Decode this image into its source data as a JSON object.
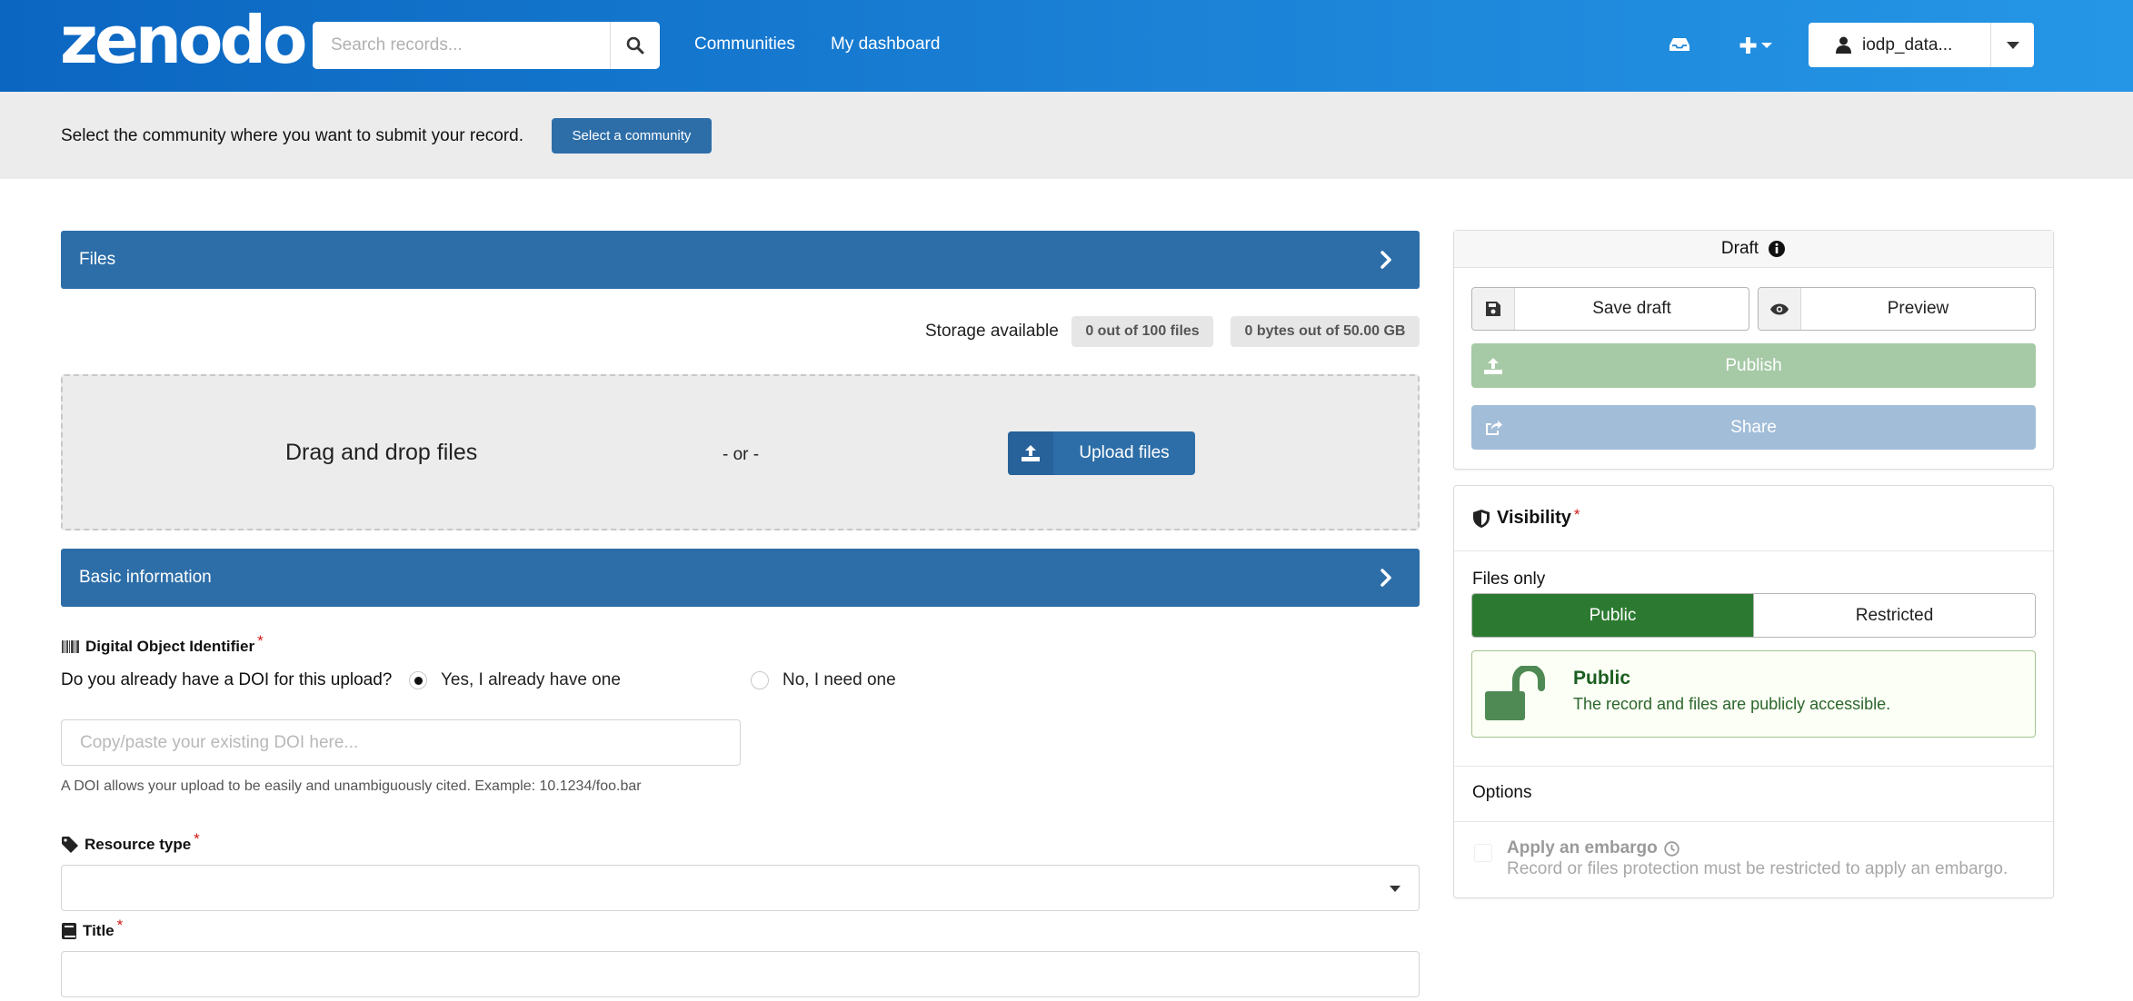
{
  "header": {
    "logo": "zenodo",
    "search_placeholder": "Search records...",
    "nav": [
      "Communities",
      "My dashboard"
    ],
    "user_label": "iodp_data..."
  },
  "community_bar": {
    "text": "Select the community where you want to submit your record.",
    "button": "Select a community"
  },
  "files": {
    "section_title": "Files",
    "storage_label": "Storage available",
    "files_quota": "0 out of 100 files",
    "bytes_quota": "0 bytes out of 50.00 GB",
    "drop_text": "Drag and drop files",
    "or_text": "- or -",
    "upload_button": "Upload files"
  },
  "basic_info": {
    "section_title": "Basic information",
    "doi_label": "Digital Object Identifier",
    "doi_question": "Do you already have a DOI for this upload?",
    "doi_options": [
      {
        "label": "Yes, I already have one",
        "selected": true
      },
      {
        "label": "No, I need one",
        "selected": false
      }
    ],
    "doi_placeholder": "Copy/paste your existing DOI here...",
    "doi_help": "A DOI allows your upload to be easily and unambiguously cited. Example: 10.1234/foo.bar",
    "resource_type_label": "Resource type",
    "title_label": "Title",
    "required_mark": "*"
  },
  "sidebar": {
    "draft_title": "Draft",
    "save_draft": "Save draft",
    "preview": "Preview",
    "publish": "Publish",
    "share": "Share",
    "visibility_title": "Visibility",
    "files_only": "Files only",
    "visibility_options": [
      "Public",
      "Restricted"
    ],
    "selected_visibility": "Public",
    "message_title": "Public",
    "message_body": "The record and files are publicly accessible.",
    "options_label": "Options",
    "embargo_label": "Apply an embargo",
    "embargo_help": "Record or files protection must be restricted to apply an embargo."
  },
  "colors": {
    "header_start": "#0b66c1",
    "header_end": "#2596e6",
    "primary": "#2d6ea8",
    "public_green": "#2c7a31",
    "publish_disabled": "#a6c9a6",
    "share_disabled": "#a2bdd8",
    "required_red": "#d01919"
  }
}
